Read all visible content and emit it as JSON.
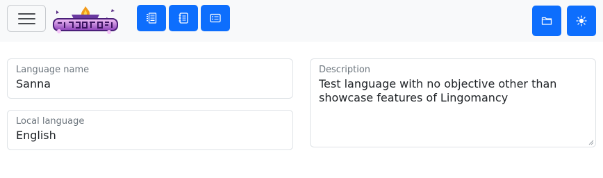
{
  "app": {
    "logo_text": "Lingomancy"
  },
  "navbar": {
    "toggle_icon": "hamburger-menu-icon",
    "view_buttons": [
      {
        "icon": "list-view-icon"
      },
      {
        "icon": "notebook-icon"
      },
      {
        "icon": "card-list-icon"
      }
    ],
    "open_folder_icon": "folder-icon",
    "theme_icon": "sun-icon"
  },
  "form": {
    "language_name": {
      "label": "Language name",
      "value": "Sanna"
    },
    "local_language": {
      "label": "Local language",
      "value": "English"
    },
    "description": {
      "label": "Description",
      "value": "Test language with no objective other than showcase features of Lingomancy"
    }
  },
  "colors": {
    "primary": "#0d6efd",
    "navbar_bg": "#f8f9fa",
    "border": "#dee2e6",
    "label": "#6c757d"
  }
}
